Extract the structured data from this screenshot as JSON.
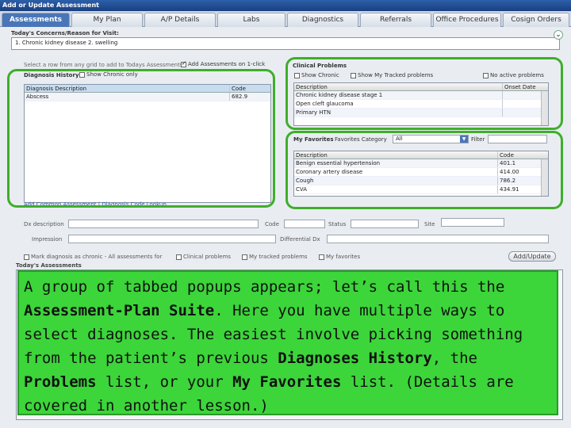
{
  "window": {
    "title": "Add or Update Assessment"
  },
  "tabs": [
    "Assessments",
    "My Plan",
    "A/P Details",
    "Labs",
    "Diagnostics",
    "Referrals",
    "Office Procedures",
    "Cosign Orders"
  ],
  "concerns": {
    "label": "Today's Concerns/Reason for Visit:",
    "value": "1. Chronic kidney disease 2. swelling"
  },
  "select_hint": "Select a row from any grid to add to Todays Assessments",
  "add_on_click": "Add Assessments on 1-click",
  "history": {
    "tab": "Diagnosis History",
    "show_chronic": "Show Chronic only",
    "columns": [
      "Diagnosis Description",
      "Code"
    ],
    "rows": [
      [
        "Abscess",
        "682.9"
      ]
    ],
    "footer": "Add Common Assessment | Diagnosis Code Lookup"
  },
  "problems": {
    "title": "Clinical Problems",
    "show_chronic": "Show Chronic",
    "show_tracked": "Show My Tracked problems",
    "no_active": "No active problems",
    "columns": [
      "Description",
      "Onset Date"
    ],
    "rows": [
      [
        "Chronic kidney disease stage 1",
        ""
      ],
      [
        "Open cleft glaucoma",
        ""
      ],
      [
        "Primary HTN",
        ""
      ]
    ]
  },
  "favorites": {
    "title": "My Favorites",
    "category_label": "Favorites Category",
    "category_value": "All",
    "filter_label": "Filter",
    "columns": [
      "Description",
      "Code"
    ],
    "rows": [
      [
        "Benign essential hypertension",
        "401.1"
      ],
      [
        "Coronary artery disease",
        "414.00"
      ],
      [
        "Cough",
        "786.2"
      ],
      [
        "CVA",
        "434.91"
      ]
    ]
  },
  "detail": {
    "desc": "Dx description",
    "code": "Code",
    "status": "Status",
    "site": "Site",
    "impression": "Impression",
    "differential": "Differential Dx"
  },
  "flags": [
    "Mark diagnosis as chronic - All assessments for",
    "Clinical problems",
    "My tracked problems",
    "My favorites"
  ],
  "add_update": "Add/Update",
  "todays": "Today's Assessments",
  "note": {
    "p1": "A group of tabbed popups appears; let’s call this the ",
    "b1": "Assessment-Plan Suite",
    "p2": ". Here you have multiple ways to select diagnoses. The easiest involve picking something from the patient’s previous ",
    "b2": "Diagnoses History",
    "p3": ", the ",
    "b3": "Problems",
    "p4": " list, or your ",
    "b4": "My Favorites",
    "p5": " list. (Details are covered in another lesson.)"
  }
}
